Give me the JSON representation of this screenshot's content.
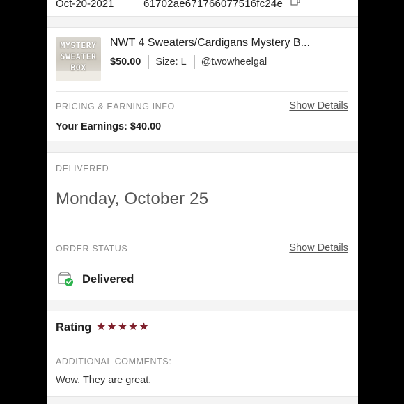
{
  "order": {
    "date": "Oct-20-2021",
    "id": "61702ae671766077516fc24e"
  },
  "item": {
    "thumbnail_lines": [
      "MYSTERY",
      "SWEATER",
      "BOX"
    ],
    "title": "NWT 4 Sweaters/Cardigans Mystery B...",
    "price": "$50.00",
    "size": "Size: L",
    "seller": "@twowheelgal"
  },
  "pricing": {
    "label": "PRICING & EARNING INFO",
    "show_details": "Show Details",
    "earnings": "Your Earnings: $40.00"
  },
  "delivery": {
    "label": "DELIVERED",
    "date": "Monday, October 25"
  },
  "order_status": {
    "label": "ORDER STATUS",
    "show_details": "Show Details",
    "status": "Delivered",
    "icon": "package-delivered-icon",
    "icon_accent_color": "#2bb24c"
  },
  "rating": {
    "label": "Rating",
    "stars": 5,
    "max_stars": 5,
    "star_color": "#7e1e2a",
    "comments_label": "ADDITIONAL COMMENTS:",
    "comment": "Wow. They are great."
  }
}
